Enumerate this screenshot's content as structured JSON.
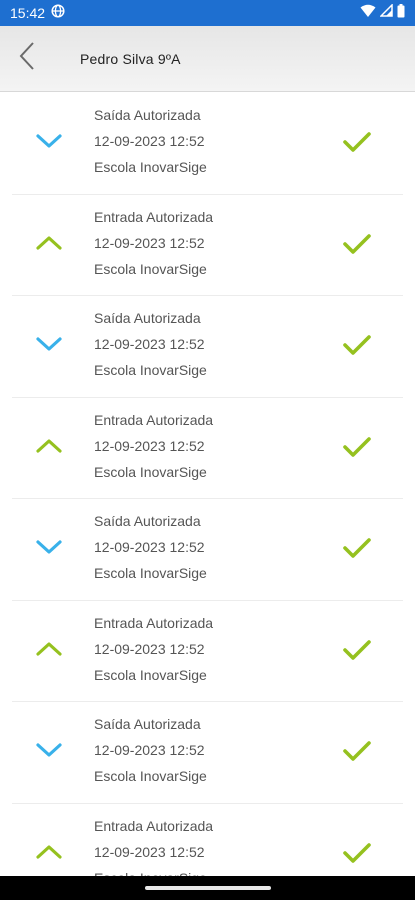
{
  "status_bar": {
    "time": "15:42"
  },
  "header": {
    "title": "Pedro Silva  9ºA"
  },
  "colors": {
    "exit": "#39b1ea",
    "entry": "#95c11f",
    "check": "#95c11f",
    "status_bar": "#1e6fd0"
  },
  "records": [
    {
      "direction": "exit",
      "label": "Saída Autorizada",
      "datetime": "12-09-2023 12:52",
      "school": "Escola InovarSige",
      "icon": "chevron-down-icon"
    },
    {
      "direction": "entry",
      "label": "Entrada Autorizada",
      "datetime": "12-09-2023 12:52",
      "school": "Escola InovarSige",
      "icon": "chevron-up-icon"
    },
    {
      "direction": "exit",
      "label": "Saída Autorizada",
      "datetime": "12-09-2023 12:52",
      "school": "Escola InovarSige",
      "icon": "chevron-down-icon"
    },
    {
      "direction": "entry",
      "label": "Entrada Autorizada",
      "datetime": "12-09-2023 12:52",
      "school": "Escola InovarSige",
      "icon": "chevron-up-icon"
    },
    {
      "direction": "exit",
      "label": "Saída Autorizada",
      "datetime": "12-09-2023 12:52",
      "school": "Escola InovarSige",
      "icon": "chevron-down-icon"
    },
    {
      "direction": "entry",
      "label": "Entrada Autorizada",
      "datetime": "12-09-2023 12:52",
      "school": "Escola InovarSige",
      "icon": "chevron-up-icon"
    },
    {
      "direction": "exit",
      "label": "Saída Autorizada",
      "datetime": "12-09-2023 12:52",
      "school": "Escola InovarSige",
      "icon": "chevron-down-icon"
    },
    {
      "direction": "entry",
      "label": "Entrada Autorizada",
      "datetime": "12-09-2023 12:52",
      "school": "Escola InovarSige",
      "icon": "chevron-up-icon"
    }
  ]
}
